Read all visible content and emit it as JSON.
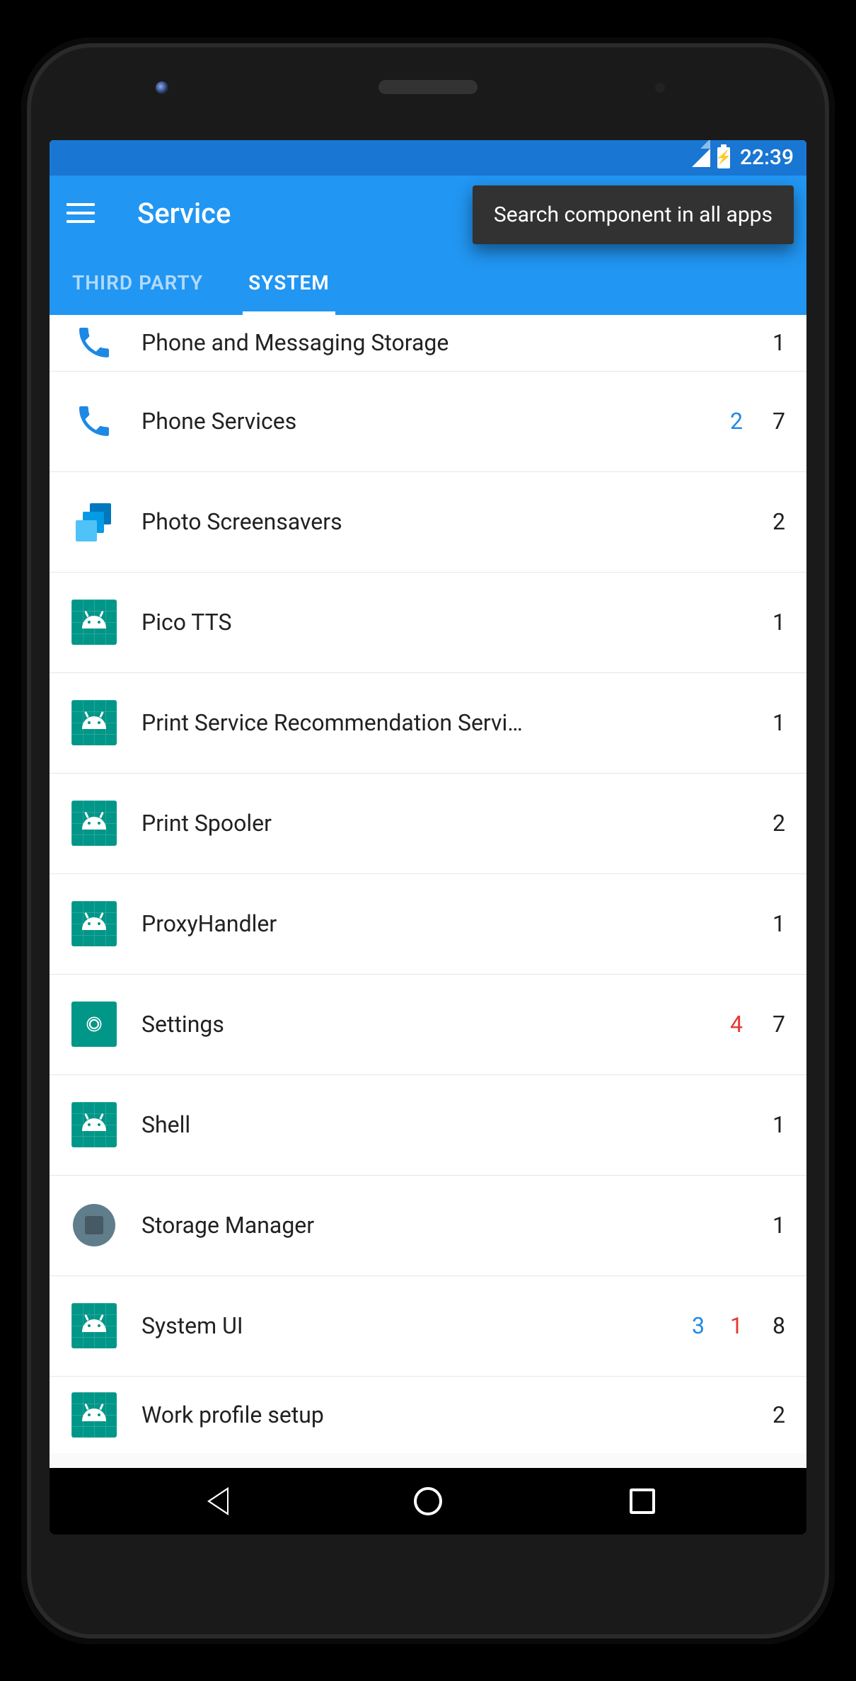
{
  "statusbar": {
    "time": "22:39"
  },
  "toolbar": {
    "title": "Service"
  },
  "tooltip": {
    "text": "Search component in all apps"
  },
  "tabs": {
    "third_party": "THIRD PARTY",
    "system": "SYSTEM",
    "active": "system"
  },
  "list": {
    "items": [
      {
        "name": "Phone and Messaging Storage",
        "icon": "phone",
        "blue": null,
        "red": null,
        "total": 1
      },
      {
        "name": "Phone Services",
        "icon": "phone",
        "blue": 2,
        "red": null,
        "total": 7
      },
      {
        "name": "Photo Screensavers",
        "icon": "photos",
        "blue": null,
        "red": null,
        "total": 2
      },
      {
        "name": "Pico TTS",
        "icon": "android",
        "blue": null,
        "red": null,
        "total": 1
      },
      {
        "name": "Print Service Recommendation Servi…",
        "icon": "android",
        "blue": null,
        "red": null,
        "total": 1
      },
      {
        "name": "Print Spooler",
        "icon": "android",
        "blue": null,
        "red": null,
        "total": 2
      },
      {
        "name": "ProxyHandler",
        "icon": "android",
        "blue": null,
        "red": null,
        "total": 1
      },
      {
        "name": "Settings",
        "icon": "gear",
        "blue": null,
        "red": 4,
        "total": 7
      },
      {
        "name": "Shell",
        "icon": "android",
        "blue": null,
        "red": null,
        "total": 1
      },
      {
        "name": "Storage Manager",
        "icon": "storage",
        "blue": null,
        "red": null,
        "total": 1
      },
      {
        "name": "System UI",
        "icon": "android",
        "blue": 3,
        "red": 1,
        "total": 8
      },
      {
        "name": "Work profile setup",
        "icon": "android",
        "blue": null,
        "red": null,
        "total": 2
      }
    ]
  }
}
